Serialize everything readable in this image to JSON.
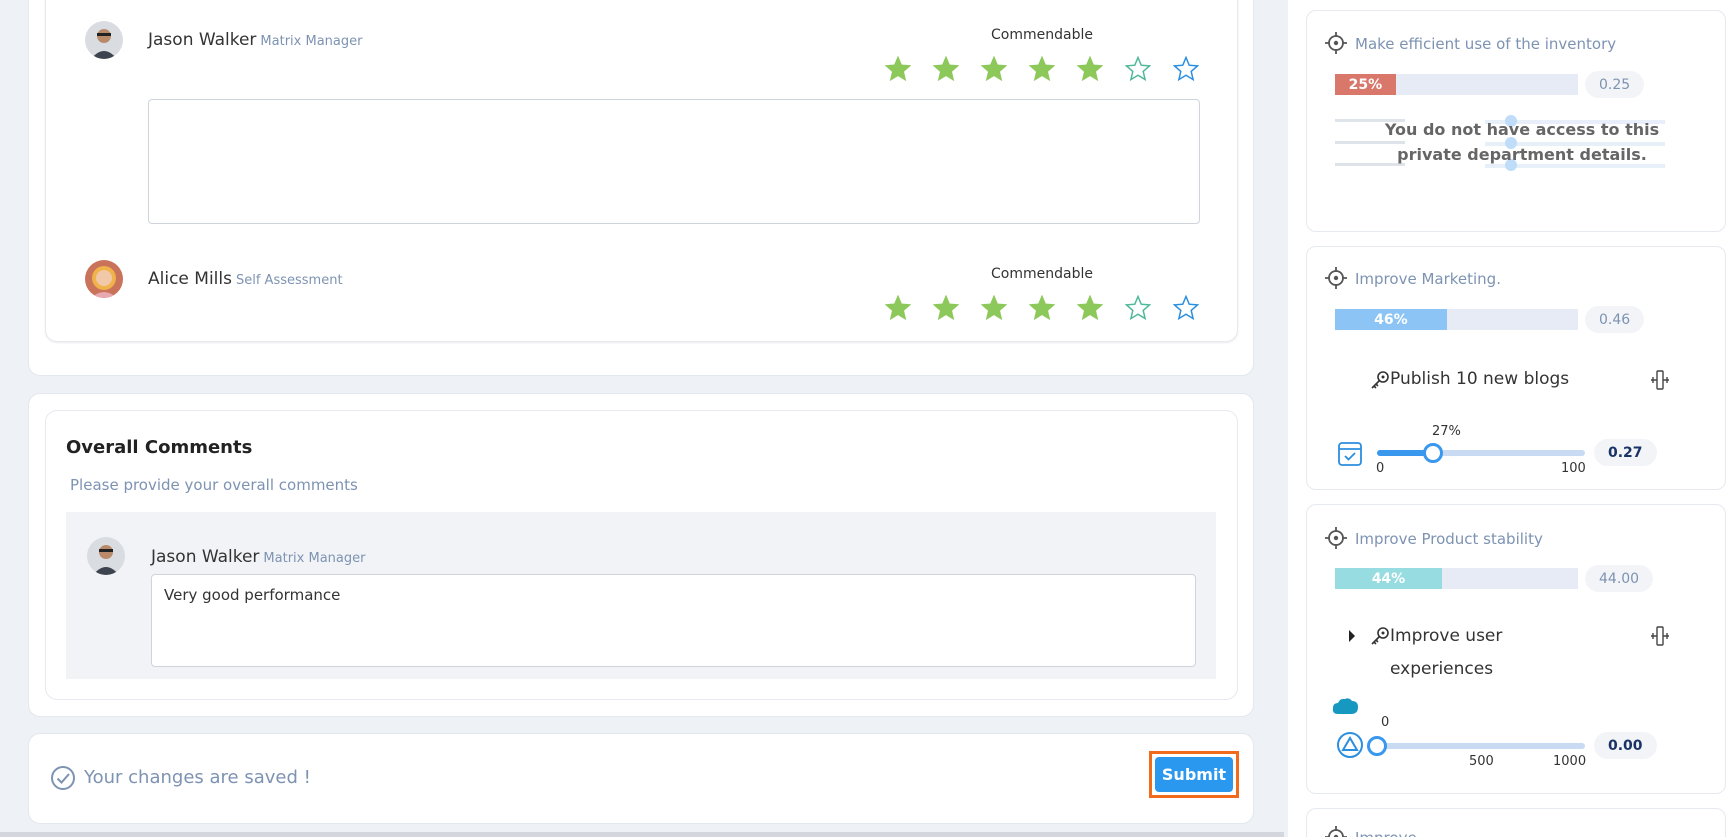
{
  "reviews": [
    {
      "name": "Jason Walker",
      "role": "Matrix Manager",
      "rating_label": "Commendable",
      "rating": 5,
      "max": 7,
      "comment": ""
    },
    {
      "name": "Alice Mills",
      "role": "Self Assessment",
      "rating_label": "Commendable",
      "rating": 5,
      "max": 7
    }
  ],
  "overall": {
    "title": "Overall Comments",
    "subtitle": "Please provide your overall comments",
    "comment": {
      "name": "Jason Walker",
      "role": "Matrix Manager",
      "text": "Very good performance"
    }
  },
  "footer": {
    "saved_message": "Your changes are saved !",
    "submit_label": "Submit"
  },
  "colors": {
    "star_filled": "#8cc85a",
    "star_empty_1": "#4fb89a",
    "star_empty_2": "#2b8fe0",
    "accent": "#2b98f0",
    "highlight": "#f26a1b"
  },
  "goals": [
    {
      "title": "Make efficient use of the inventory",
      "progress_label": "25%",
      "progress": 25,
      "value": "0.25",
      "color": "#d9776b",
      "private_message": "You do not have access to this private department details."
    },
    {
      "title": "Improve Marketing.",
      "progress_label": "46%",
      "progress": 46,
      "value": "0.46",
      "color": "#8cc4f5",
      "key_result": {
        "title": "Publish 10 new blogs",
        "slider_label": "27%",
        "slider_value": 27,
        "min": "0",
        "max": "100",
        "value": "0.27"
      }
    },
    {
      "title": "Improve Product stability",
      "progress_label": "44%",
      "progress": 44,
      "value": "44.00",
      "color": "#96dce0",
      "key_result": {
        "title": "Improve user experiences",
        "slider_label": "0",
        "slider_value": 0,
        "min_tick": "500",
        "max": "1000",
        "value": "0.00"
      }
    },
    {
      "title": "Improve ..."
    }
  ]
}
